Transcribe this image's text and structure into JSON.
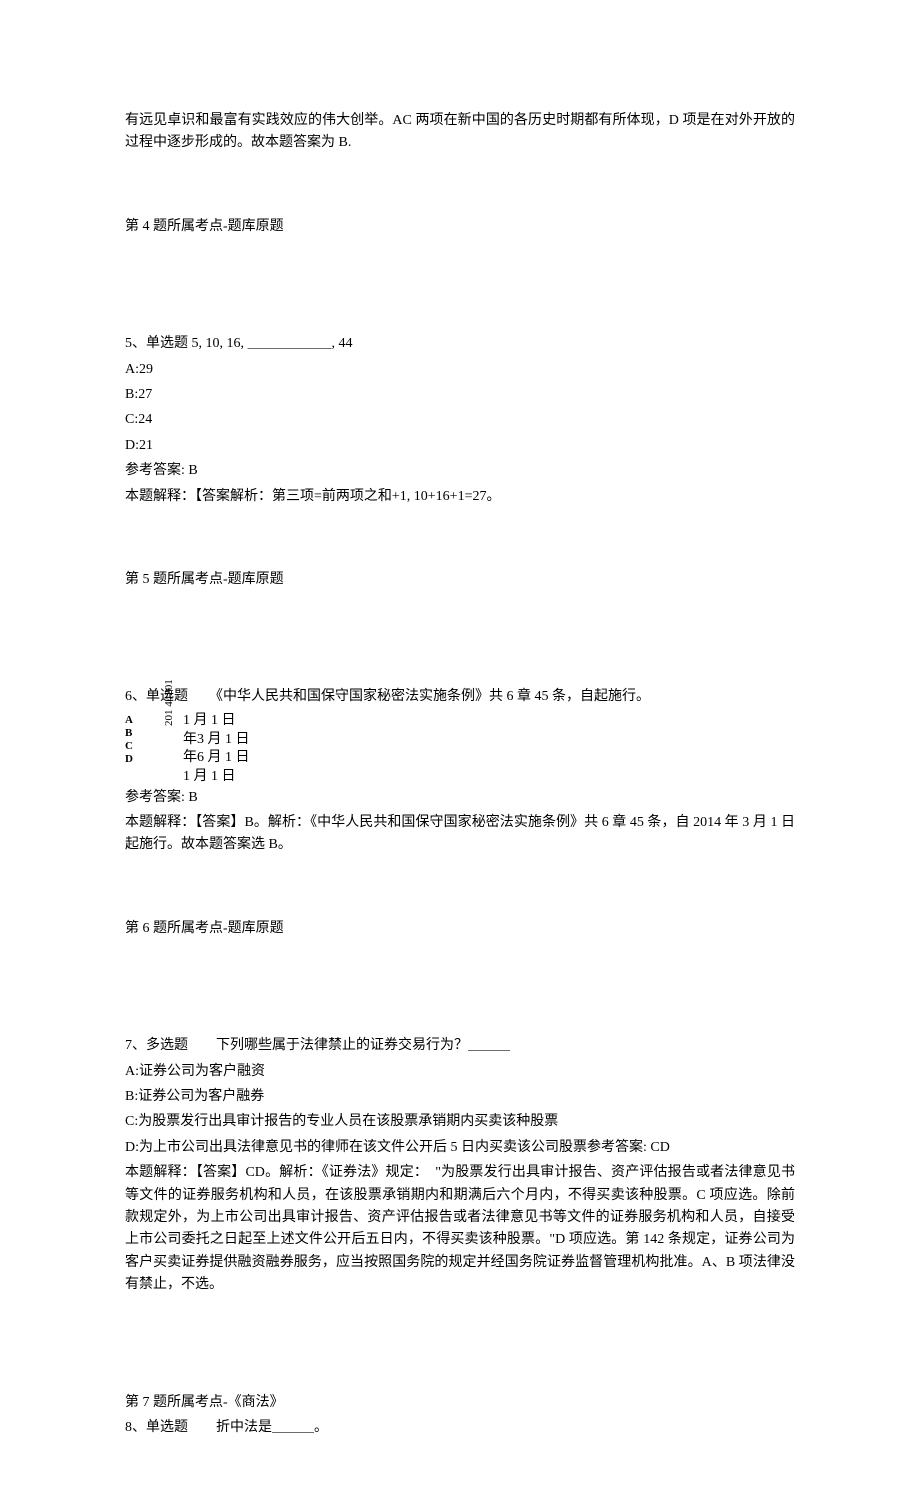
{
  "intro": {
    "line1": "有远见卓识和最富有实践效应的伟大创举。AC 两项在新中国的各历史时期都有所体现，D 项是在对外开放的过程中逐步形成的。故本题答案为 B."
  },
  "q4": {
    "topic": "第 4 题所属考点-题库原题"
  },
  "q5": {
    "stem": "5、单选题 5, 10, 16, ＿＿＿＿＿＿, 44",
    "optA": "A:29",
    "optB": "B:27",
    "optC": "C:24",
    "optD": "D:21",
    "ans": "参考答案: B",
    "explain": "本题解释：【答案解析：第三项=前两项之和+1, 10+16+1=27。",
    "topic": "第 5 题所属考点-题库原题"
  },
  "q6": {
    "stem": "6、单选题　　《中华人民共和国保守国家秘密法实施条例》共 6 章 45 条，自起施行。",
    "labels": {
      "a": "A",
      "b": "B",
      "c": "C",
      "d": "D"
    },
    "years": "201 44201",
    "dateA": "1 月 1 日",
    "dateB": "年3 月 1 日",
    "dateC": "年6 月 1 日",
    "dateD": "1 月 1 日",
    "ans": "参考答案: B",
    "explain": "本题解释：【答案】B。解析：《中华人民共和国保守国家秘密法实施条例》共 6 章 45 条，自 2014 年 3 月 1 日起施行。故本题答案选 B。",
    "topic": "第 6 题所属考点-题库原题"
  },
  "q7": {
    "stem": "7、多选题　　下列哪些属于法律禁止的证券交易行为？＿＿＿",
    "optA": "A:证券公司为客户融资",
    "optB": "B:证券公司为客户融券",
    "optC": "C:为股票发行出具审计报告的专业人员在该股票承销期内买卖该种股票",
    "optD": "D:为上市公司出具法律意见书的律师在该文件公开后 5 日内买卖该公司股票参考答案: CD",
    "explain": "本题解释：【答案】CD。解析：《证券法》规定：　\"为股票发行出具审计报告、资产评估报告或者法律意见书等文件的证券服务机构和人员，在该股票承销期内和期满后六个月内，不得买卖该种股票。C 项应选。除前款规定外，为上市公司出具审计报告、资产评估报告或者法律意见书等文件的证券服务机构和人员，自接受上市公司委托之日起至上述文件公开后五日内，不得买卖该种股票。\"D 项应选。第 142 条规定，证券公司为客户买卖证券提供融资融券服务，应当按照国务院的规定并经国务院证券监督管理机构批准。A、B 项法律没有禁止，不选。",
    "topic": "第 7 题所属考点-《商法》"
  },
  "q8": {
    "stem": "8、单选题　　折中法是＿＿＿。"
  }
}
